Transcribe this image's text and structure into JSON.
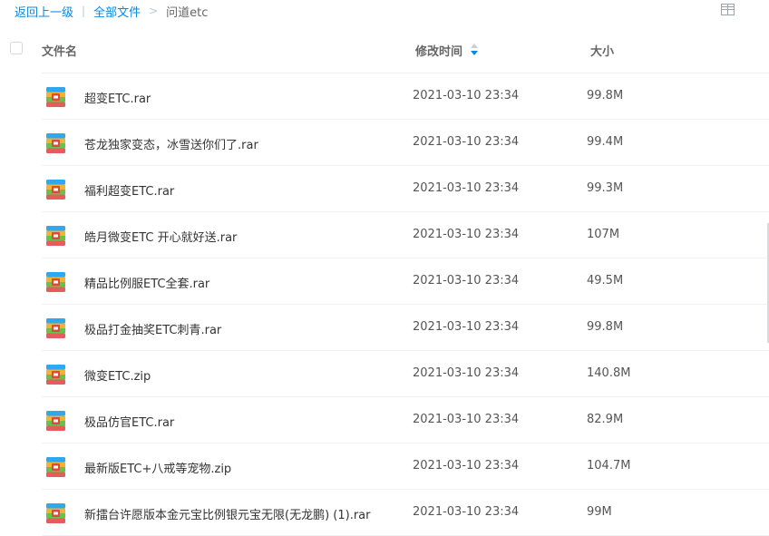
{
  "breadcrumb": {
    "back": "返回上一级",
    "separator1": "|",
    "all_files": "全部文件",
    "separator2": ">",
    "current": "问道etc"
  },
  "header": {
    "name": "文件名",
    "modified": "修改时间",
    "size": "大小"
  },
  "files": [
    {
      "name": "超变ETC.rar",
      "time": "2021-03-10 23:34",
      "size": "99.8M",
      "icon": "archive-icon"
    },
    {
      "name": "苍龙独家变态，冰雪送你们了.rar",
      "time": "2021-03-10 23:34",
      "size": "99.4M",
      "icon": "archive-icon"
    },
    {
      "name": "福利超变ETC.rar",
      "time": "2021-03-10 23:34",
      "size": "99.3M",
      "icon": "archive-icon"
    },
    {
      "name": "皓月微变ETC 开心就好送.rar",
      "time": "2021-03-10 23:34",
      "size": "107M",
      "icon": "archive-icon"
    },
    {
      "name": "精品比例服ETC全套.rar",
      "time": "2021-03-10 23:34",
      "size": "49.5M",
      "icon": "archive-icon"
    },
    {
      "name": "极品打金抽奖ETC刺青.rar",
      "time": "2021-03-10 23:34",
      "size": "99.8M",
      "icon": "archive-icon"
    },
    {
      "name": "微变ETC.zip",
      "time": "2021-03-10 23:34",
      "size": "140.8M",
      "icon": "archive-icon"
    },
    {
      "name": "极品仿官ETC.rar",
      "time": "2021-03-10 23:34",
      "size": "82.9M",
      "icon": "archive-icon"
    },
    {
      "name": "最新版ETC+八戒等宠物.zip",
      "time": "2021-03-10 23:34",
      "size": "104.7M",
      "icon": "archive-icon"
    },
    {
      "name": "新擂台许愿版本金元宝比例银元宝无限(无龙鹏) (1).rar",
      "time": "2021-03-10 23:34",
      "size": "99M",
      "icon": "archive-icon"
    }
  ],
  "colors": {
    "link": "#0a88e0",
    "sort_arrow": "#0a88e0"
  }
}
